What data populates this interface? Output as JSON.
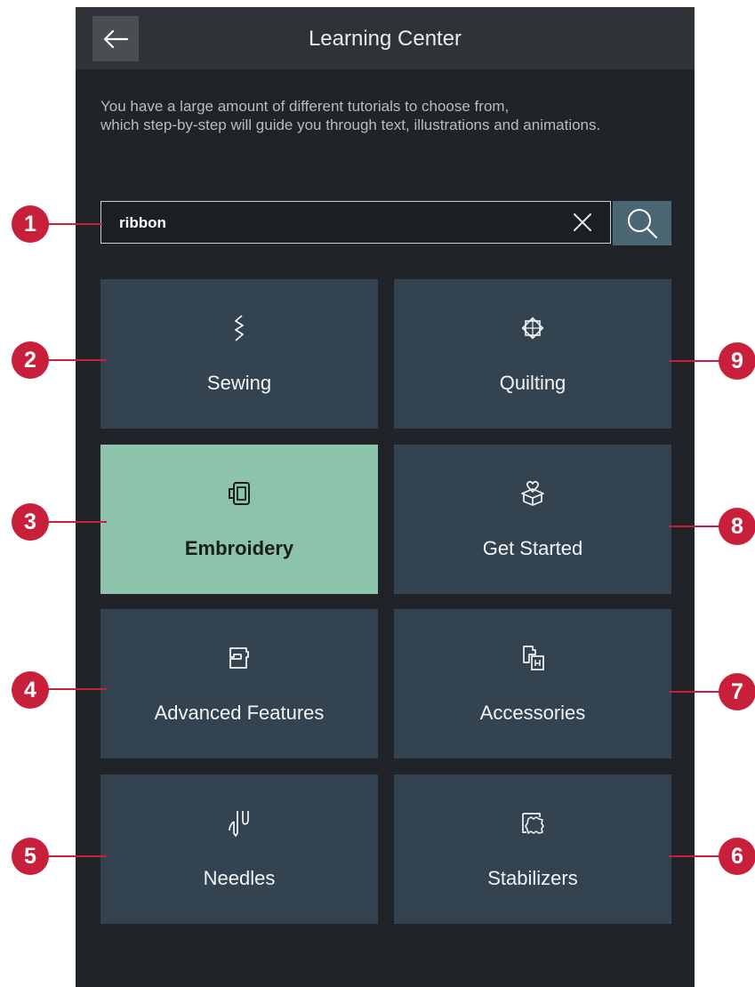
{
  "header": {
    "title": "Learning Center",
    "back_icon": "arrow-left-icon"
  },
  "intro_text": "You have a large amount of different tutorials to choose from,\nwhich step-by-step will guide you through text, illustrations and animations.",
  "search": {
    "value": "ribbon",
    "clear_icon": "close-icon",
    "search_icon": "search-icon"
  },
  "tiles": [
    {
      "label": "Sewing",
      "icon": "zigzag-stitch-icon",
      "selected": false
    },
    {
      "label": "Quilting",
      "icon": "quilt-star-icon",
      "selected": false
    },
    {
      "label": "Embroidery",
      "icon": "embroidery-hoop-icon",
      "selected": true
    },
    {
      "label": "Get Started",
      "icon": "gift-heart-icon",
      "selected": false
    },
    {
      "label": "Advanced Features",
      "icon": "sewing-machine-icon",
      "selected": false
    },
    {
      "label": "Accessories",
      "icon": "presser-foot-icon",
      "selected": false
    },
    {
      "label": "Needles",
      "icon": "needle-icon",
      "selected": false
    },
    {
      "label": "Stabilizers",
      "icon": "stabilizer-icon",
      "selected": false
    }
  ],
  "callouts": [
    "1",
    "2",
    "3",
    "4",
    "5",
    "6",
    "7",
    "8",
    "9"
  ],
  "colors": {
    "background": "#202428",
    "header": "#2f3337",
    "tile": "#33434f",
    "tile_selected": "#8cc3aa",
    "search_button": "#4a6673",
    "callout": "#c8203a"
  }
}
